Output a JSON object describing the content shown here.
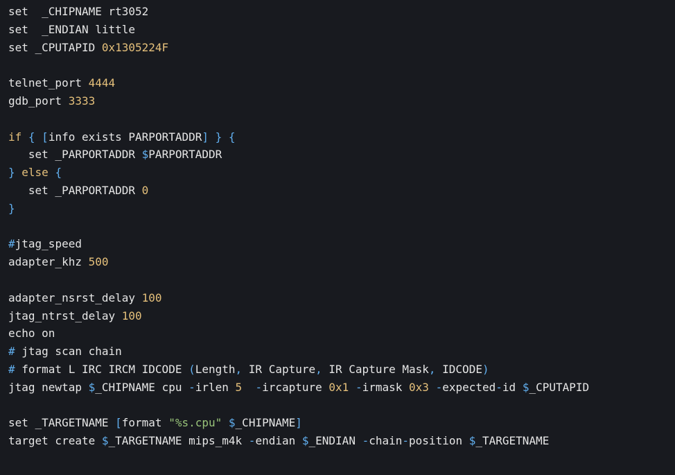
{
  "colors": {
    "background": "#181a1f",
    "plain": "#e6e6e6",
    "number": "#e5c07b",
    "punctuation": "#61afef",
    "keyword": "#e5c07b",
    "comment": "#61afef",
    "string": "#98c379"
  },
  "lines": [
    [
      {
        "t": "set  _CHIPNAME rt3052",
        "k": "plain"
      }
    ],
    [
      {
        "t": "set  _ENDIAN little",
        "k": "plain"
      }
    ],
    [
      {
        "t": "set _CPUTAPID ",
        "k": "plain"
      },
      {
        "t": "0x1305224F",
        "k": "num"
      }
    ],
    [],
    [
      {
        "t": "telnet_port ",
        "k": "plain"
      },
      {
        "t": "4444",
        "k": "num"
      }
    ],
    [
      {
        "t": "gdb_port ",
        "k": "plain"
      },
      {
        "t": "3333",
        "k": "num"
      }
    ],
    [],
    [
      {
        "t": "if ",
        "k": "keyword"
      },
      {
        "t": "{ [",
        "k": "punct"
      },
      {
        "t": "info exists PARPORTADDR",
        "k": "plain"
      },
      {
        "t": "] }",
        "k": "punct"
      },
      {
        "t": " {",
        "k": "punct"
      }
    ],
    [
      {
        "t": "   set _PARPORTADDR ",
        "k": "plain"
      },
      {
        "t": "$",
        "k": "punct"
      },
      {
        "t": "PARPORTADDR",
        "k": "plain"
      }
    ],
    [
      {
        "t": "} ",
        "k": "punct"
      },
      {
        "t": "else ",
        "k": "keyword"
      },
      {
        "t": "{",
        "k": "punct"
      }
    ],
    [
      {
        "t": "   set _PARPORTADDR ",
        "k": "plain"
      },
      {
        "t": "0",
        "k": "num"
      }
    ],
    [
      {
        "t": "}",
        "k": "punct"
      }
    ],
    [],
    [
      {
        "t": "#",
        "k": "comment"
      },
      {
        "t": "jtag_speed",
        "k": "plain"
      }
    ],
    [
      {
        "t": "adapter_khz ",
        "k": "plain"
      },
      {
        "t": "500",
        "k": "num"
      }
    ],
    [],
    [
      {
        "t": "adapter_nsrst_delay ",
        "k": "plain"
      },
      {
        "t": "100",
        "k": "num"
      }
    ],
    [
      {
        "t": "jtag_ntrst_delay ",
        "k": "plain"
      },
      {
        "t": "100",
        "k": "num"
      }
    ],
    [
      {
        "t": "echo on",
        "k": "plain"
      }
    ],
    [
      {
        "t": "# ",
        "k": "comment"
      },
      {
        "t": "jtag scan chain",
        "k": "plain"
      }
    ],
    [
      {
        "t": "# ",
        "k": "comment"
      },
      {
        "t": "format L IRC IRCM IDCODE ",
        "k": "plain"
      },
      {
        "t": "(",
        "k": "punct"
      },
      {
        "t": "Length",
        "k": "plain"
      },
      {
        "t": ", ",
        "k": "punct"
      },
      {
        "t": "IR Capture",
        "k": "plain"
      },
      {
        "t": ", ",
        "k": "punct"
      },
      {
        "t": "IR Capture Mask",
        "k": "plain"
      },
      {
        "t": ", ",
        "k": "punct"
      },
      {
        "t": "IDCODE",
        "k": "plain"
      },
      {
        "t": ")",
        "k": "punct"
      }
    ],
    [
      {
        "t": "jtag newtap ",
        "k": "plain"
      },
      {
        "t": "$",
        "k": "punct"
      },
      {
        "t": "_CHIPNAME cpu ",
        "k": "plain"
      },
      {
        "t": "-",
        "k": "punct"
      },
      {
        "t": "irlen ",
        "k": "plain"
      },
      {
        "t": "5",
        "k": "num"
      },
      {
        "t": "  ",
        "k": "plain"
      },
      {
        "t": "-",
        "k": "punct"
      },
      {
        "t": "ircapture ",
        "k": "plain"
      },
      {
        "t": "0x1",
        "k": "num"
      },
      {
        "t": " ",
        "k": "plain"
      },
      {
        "t": "-",
        "k": "punct"
      },
      {
        "t": "irmask ",
        "k": "plain"
      },
      {
        "t": "0x3",
        "k": "num"
      },
      {
        "t": " ",
        "k": "plain"
      },
      {
        "t": "-",
        "k": "punct"
      },
      {
        "t": "expected",
        "k": "plain"
      },
      {
        "t": "-",
        "k": "punct"
      },
      {
        "t": "id ",
        "k": "plain"
      },
      {
        "t": "$",
        "k": "punct"
      },
      {
        "t": "_CPUTAPID",
        "k": "plain"
      }
    ],
    [],
    [
      {
        "t": "set _TARGETNAME ",
        "k": "plain"
      },
      {
        "t": "[",
        "k": "punct"
      },
      {
        "t": "format ",
        "k": "plain"
      },
      {
        "t": "\"%s.cpu\"",
        "k": "string"
      },
      {
        "t": " ",
        "k": "plain"
      },
      {
        "t": "$",
        "k": "punct"
      },
      {
        "t": "_CHIPNAME",
        "k": "plain"
      },
      {
        "t": "]",
        "k": "punct"
      }
    ],
    [
      {
        "t": "target create ",
        "k": "plain"
      },
      {
        "t": "$",
        "k": "punct"
      },
      {
        "t": "_TARGETNAME mips_m4k ",
        "k": "plain"
      },
      {
        "t": "-",
        "k": "punct"
      },
      {
        "t": "endian ",
        "k": "plain"
      },
      {
        "t": "$",
        "k": "punct"
      },
      {
        "t": "_ENDIAN ",
        "k": "plain"
      },
      {
        "t": "-",
        "k": "punct"
      },
      {
        "t": "chain",
        "k": "plain"
      },
      {
        "t": "-",
        "k": "punct"
      },
      {
        "t": "position ",
        "k": "plain"
      },
      {
        "t": "$",
        "k": "punct"
      },
      {
        "t": "_TARGETNAME",
        "k": "plain"
      }
    ]
  ]
}
